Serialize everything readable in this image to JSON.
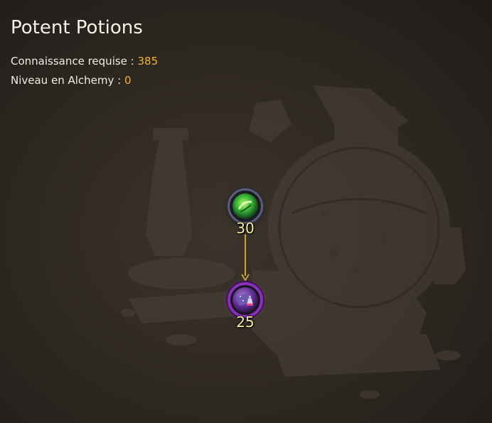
{
  "tree": {
    "title": "Potent Potions",
    "knowledge_label": "Connaissance requise : ",
    "knowledge_value": "385",
    "level_label": "Niveau en Alchemy : ",
    "level_value": "0"
  },
  "nodes": [
    {
      "id": "green-potion",
      "icon": "green-potion-icon",
      "cost": "30",
      "color": "#3fbf3a"
    },
    {
      "id": "purple-potion",
      "icon": "purple-potion-icon",
      "cost": "25",
      "color": "#8a2fb8"
    }
  ],
  "colors": {
    "accent": "#f2b233",
    "connector": "#c9a23a",
    "node_label": "#f4ef9a"
  }
}
